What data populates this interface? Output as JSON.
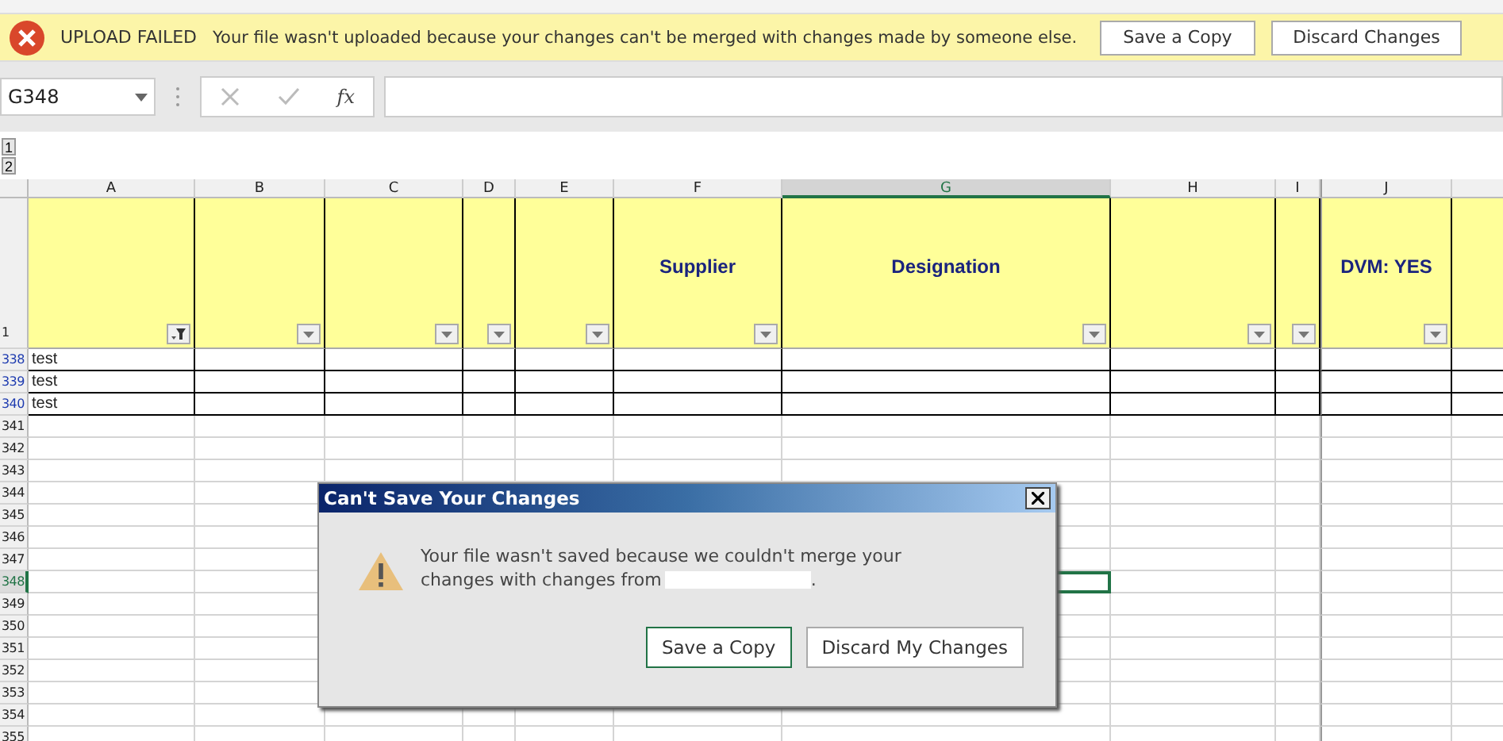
{
  "notification": {
    "title": "UPLOAD FAILED",
    "message": "Your file wasn't uploaded because your changes can't be merged with changes made by someone else.",
    "buttons": [
      "Save a Copy",
      "Discard Changes"
    ]
  },
  "formula_bar": {
    "name_box": "G348",
    "function_label": "fx"
  },
  "outline_levels": [
    "1",
    "2"
  ],
  "columns": [
    {
      "letter": "A",
      "filtered": true,
      "selected": false
    },
    {
      "letter": "B",
      "filtered": false,
      "selected": false
    },
    {
      "letter": "C",
      "filtered": false,
      "selected": false
    },
    {
      "letter": "D",
      "filtered": false,
      "selected": false
    },
    {
      "letter": "E",
      "filtered": false,
      "selected": false
    },
    {
      "letter": "F",
      "header": "Supplier",
      "filtered": false,
      "selected": false
    },
    {
      "letter": "G",
      "header": "Designation",
      "filtered": false,
      "selected": true
    },
    {
      "letter": "H",
      "filtered": false,
      "selected": false
    },
    {
      "letter": "I",
      "filtered": false,
      "selected": false
    },
    {
      "letter": "J",
      "header": "DVM: YES",
      "filtered": false,
      "selected": false
    }
  ],
  "header_row": "1",
  "rows": [
    {
      "number": "338",
      "filtered": true,
      "selected": false,
      "cells": [
        "test"
      ]
    },
    {
      "number": "339",
      "filtered": true,
      "selected": false,
      "cells": [
        "test"
      ]
    },
    {
      "number": "340",
      "filtered": true,
      "selected": false,
      "cells": [
        "test"
      ]
    },
    {
      "number": "341",
      "filtered": false,
      "selected": false
    },
    {
      "number": "342",
      "filtered": false,
      "selected": false
    },
    {
      "number": "343",
      "filtered": false,
      "selected": false
    },
    {
      "number": "344",
      "filtered": false,
      "selected": false
    },
    {
      "number": "345",
      "filtered": false,
      "selected": false
    },
    {
      "number": "346",
      "filtered": false,
      "selected": false
    },
    {
      "number": "347",
      "filtered": false,
      "selected": false
    },
    {
      "number": "348",
      "filtered": false,
      "selected": true
    },
    {
      "number": "349",
      "filtered": false,
      "selected": false
    },
    {
      "number": "350",
      "filtered": false,
      "selected": false
    },
    {
      "number": "351",
      "filtered": false,
      "selected": false
    },
    {
      "number": "352",
      "filtered": false,
      "selected": false
    },
    {
      "number": "353",
      "filtered": false,
      "selected": false
    },
    {
      "number": "354",
      "filtered": false,
      "selected": false
    },
    {
      "number": "355",
      "filtered": false,
      "selected": false
    }
  ],
  "dialog": {
    "title": "Can't Save Your Changes",
    "message_lines": [
      "Your file wasn't saved because we couldn't merge your",
      "changes with changes from"
    ],
    "message_end": ".",
    "buttons": [
      {
        "label": "Save a Copy",
        "default": true
      },
      {
        "label": "Discard My Changes",
        "default": false
      }
    ]
  }
}
